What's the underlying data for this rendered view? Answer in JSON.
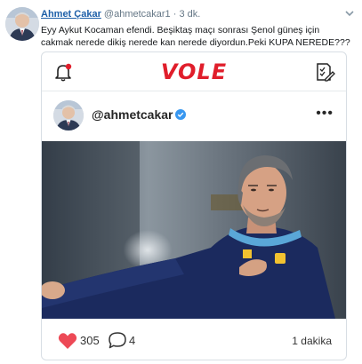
{
  "tweet": {
    "author_name": "Ahmet Çakar",
    "author_handle": "@ahmetcakar1",
    "separator": "·",
    "time": "3 dk.",
    "text": "Eyy Aykut Kocaman efendi. Beşiktaş maçı sonrası Şenol güneş için cakmak nerede dikiş nerede kan nerede diyordun.Peki KUPA NEREDE???"
  },
  "card": {
    "brand": "VOLE",
    "brand_color": "#e01e2b",
    "left_icon": "notification-bell-icon",
    "right_icon": "news-edit-icon",
    "post_username": "@ahmetcakar",
    "verified_color": "#3897f0",
    "more_label": "•••",
    "likes": "305",
    "comments": "4",
    "posted_ago": "1 dakika",
    "heart_color": "#ed4956"
  },
  "colors": {
    "link_blue": "#1d5fa8",
    "muted": "#657786"
  }
}
